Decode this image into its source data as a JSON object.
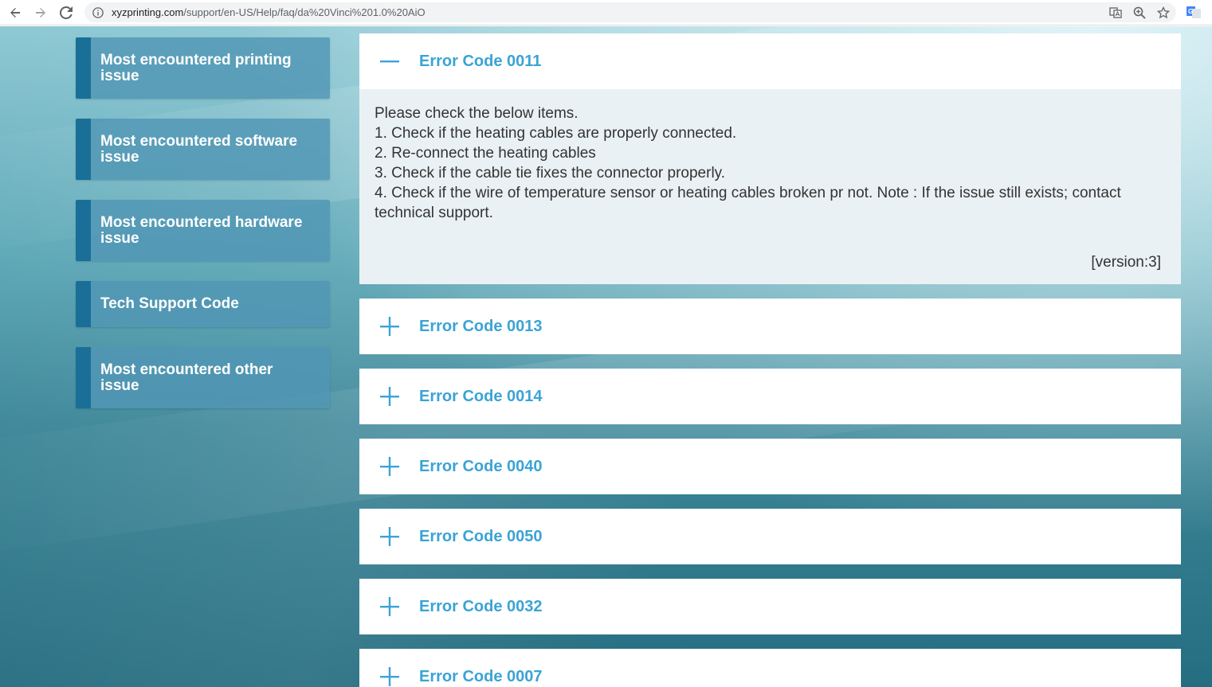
{
  "browser": {
    "url_host": "xyzprinting.com",
    "url_path": "/support/en-US/Help/faq/da%20Vinci%201.0%20AiO"
  },
  "sidebar": {
    "items": [
      {
        "label": "Most encountered printing issue"
      },
      {
        "label": "Most encountered software issue"
      },
      {
        "label": "Most encountered hardware issue"
      },
      {
        "label": "Tech Support Code"
      },
      {
        "label": "Most encountered other issue"
      }
    ]
  },
  "accordion": {
    "expanded": {
      "title": "Error Code 0011",
      "lines": [
        "Please check the below items.",
        "1. Check if the heating cables are properly connected.",
        "2. Re-connect the heating cables",
        "3. Check if the cable tie fixes the connector properly.",
        "4. Check if the wire of temperature sensor or heating cables broken pr not. Note : If the issue still exists; contact technical support."
      ],
      "version": "[version:3]"
    },
    "collapsed": [
      {
        "title": "Error Code 0013"
      },
      {
        "title": "Error Code 0014"
      },
      {
        "title": "Error Code 0040"
      },
      {
        "title": "Error Code 0050"
      },
      {
        "title": "Error Code 0032"
      },
      {
        "title": "Error Code 0007"
      }
    ]
  },
  "colors": {
    "accent": "#3ba3d5",
    "sidebar_bar": "#1a6f98"
  }
}
